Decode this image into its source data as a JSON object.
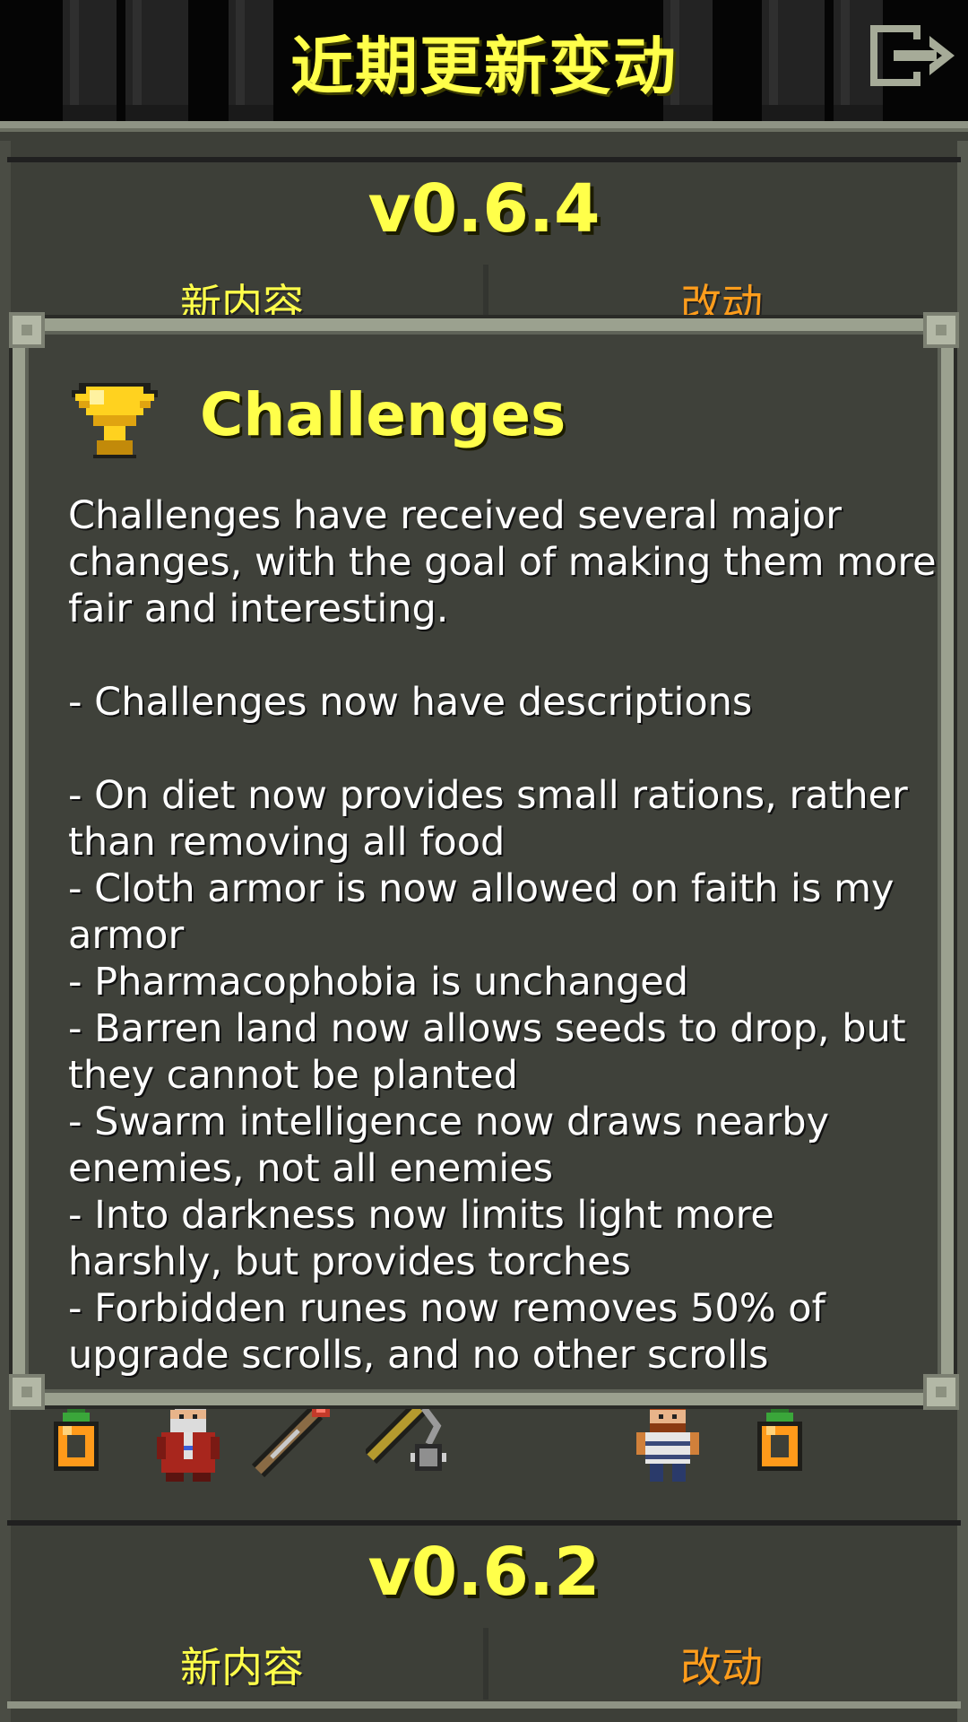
{
  "window": {
    "title": "近期更新变动"
  },
  "icons": {
    "exit": "exit-door-icon",
    "trophy": "trophy-icon"
  },
  "colors": {
    "title_yellow": "#ffff4a",
    "changes_orange": "#ff9d1c",
    "panel_bg": "#3d3f38",
    "frame": "#9ba18f"
  },
  "sections": [
    {
      "version": "v0.6.4",
      "new_label": "新内容",
      "changes_label": "改动",
      "new_icons": [
        "orange-potion-icon",
        "old-wizard-sprite-icon",
        "wand-icon",
        "flail-icon"
      ],
      "change_icons": [
        "warrior-sprite-icon",
        "orange-potion-icon"
      ]
    },
    {
      "version": "v0.6.2",
      "new_label": "新内容",
      "changes_label": "改动"
    }
  ],
  "modal": {
    "heading": "Challenges",
    "body": "Challenges have received several major changes, with the goal of making them more fair and interesting.\n\n- Challenges now have descriptions\n\n- On diet now provides small rations, rather than removing all food\n- Cloth armor is now allowed on faith is my armor\n- Pharmacophobia is unchanged\n- Barren land now allows seeds to drop, but they cannot be planted\n- Swarm intelligence now draws nearby enemies, not all enemies\n- Into darkness now limits light more harshly, but provides torches\n- Forbidden runes now removes 50% of upgrade scrolls, and no other scrolls"
  }
}
